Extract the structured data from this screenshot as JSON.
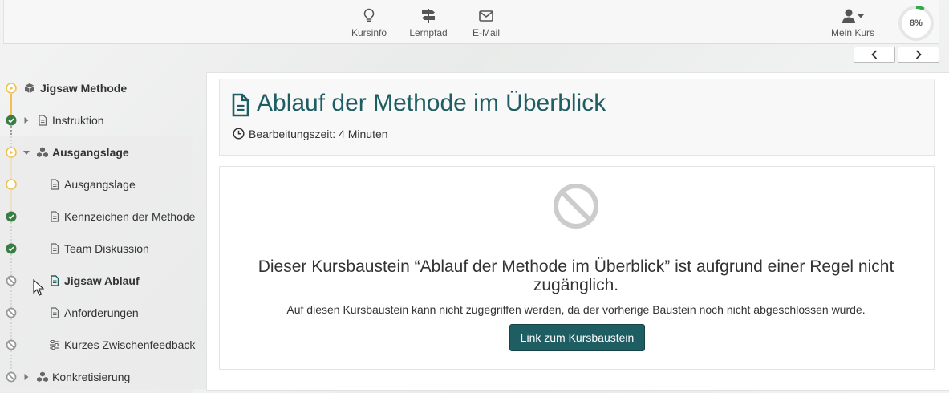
{
  "topnav": {
    "kursinfo": "Kursinfo",
    "lernpfad": "Lernpfad",
    "email": "E-Mail",
    "mein_kurs": "Mein Kurs",
    "progress_text": "8%",
    "progress": 0.08
  },
  "sidebar": {
    "items": [
      {
        "label": "Jigsaw Methode",
        "icon": "cube-icon",
        "status": "in-progress",
        "bold": true
      },
      {
        "label": "Instruktion",
        "icon": "document-icon",
        "status": "done",
        "bold": false
      },
      {
        "label": "Ausgangslage",
        "icon": "cubes-icon",
        "status": "in-progress",
        "bold": true
      },
      {
        "label": "Ausgangslage",
        "icon": "document-icon",
        "status": "ready",
        "bold": false
      },
      {
        "label": "Kennzeichen der Methode",
        "icon": "document-icon",
        "status": "done",
        "bold": false
      },
      {
        "label": "Team Diskussion",
        "icon": "document-icon",
        "status": "done",
        "bold": false
      },
      {
        "label": "Jigsaw Ablauf",
        "icon": "document-icon",
        "status": "blocked",
        "bold": true
      },
      {
        "label": "Anforderungen",
        "icon": "document-icon",
        "status": "blocked",
        "bold": false
      },
      {
        "label": "Kurzes Zwischenfeedback",
        "icon": "sliders-icon",
        "status": "blocked",
        "bold": false
      },
      {
        "label": "Konkretisierung",
        "icon": "cubes-icon",
        "status": "blocked",
        "bold": false
      }
    ]
  },
  "page": {
    "title": "Ablauf der Methode im Überblick",
    "meta": "Bearbeitungszeit: 4 Minuten",
    "blocked_title": "Dieser Kursbaustein “Ablauf der Methode im Überblick” ist aufgrund einer Regel nicht zugänglich.",
    "blocked_desc": "Auf diesen Kursbaustein kann nicht zugegriffen werden, da der vorherige Baustein noch nicht abgeschlossen wurde.",
    "button_label": "Link zum Kursbaustein"
  },
  "colors": {
    "accent": "#1e5e63",
    "done": "#3a7d44",
    "in_progress": "#f0c24d",
    "blocked": "#999999"
  }
}
